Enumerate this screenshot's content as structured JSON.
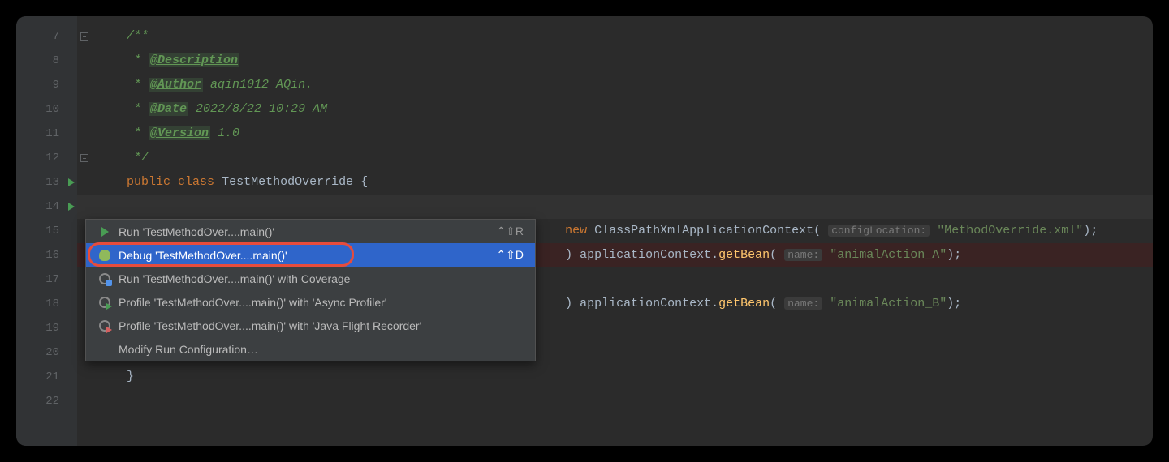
{
  "gutter": {
    "lines": [
      "7",
      "8",
      "9",
      "10",
      "11",
      "12",
      "13",
      "14",
      "15",
      "16",
      "17",
      "18",
      "19",
      "20",
      "21",
      "22"
    ]
  },
  "code": {
    "l7": "/**",
    "l8_star": " * ",
    "l8_tag": "@Description",
    "l9_star": " * ",
    "l9_tag": "@Author",
    "l9_text": " aqin1012 AQin.",
    "l10_star": " * ",
    "l10_tag": "@Date",
    "l10_text": " 2022/8/22 10:29 AM",
    "l11_star": " * ",
    "l11_tag": "@Version",
    "l11_text": " 1.0",
    "l12": " */",
    "l13_kw1": "public",
    "l13_kw2": "class",
    "l13_name": "TestMethodOverride",
    "l13_brace": " {",
    "l15_new": "new ",
    "l15_class": "ClassPathXmlApplicationContext",
    "l15_open": "(",
    "l15_hint": "configLocation:",
    "l15_str": "\"MethodOverride.xml\"",
    "l15_end": ");",
    "l16_close": ") ",
    "l16_obj": "applicationContext",
    "l16_dot": ".",
    "l16_method": "getBean",
    "l16_open": "(",
    "l16_hint": "name:",
    "l16_str": "\"animalAction_A\"",
    "l16_end": ");",
    "l18_close": ") ",
    "l18_obj": "applicationContext",
    "l18_dot": ".",
    "l18_method": "getBean",
    "l18_open": "(",
    "l18_hint": "name:",
    "l18_str": "\"animalAction_B\"",
    "l18_end": ");",
    "l21_brace": "}"
  },
  "menu": {
    "items": [
      {
        "label": "Run 'TestMethodOver....main()'",
        "shortcut": "⌃⇧R"
      },
      {
        "label": "Debug 'TestMethodOver....main()'",
        "shortcut": "⌃⇧D"
      },
      {
        "label": "Run 'TestMethodOver....main()' with Coverage",
        "shortcut": ""
      },
      {
        "label": "Profile 'TestMethodOver....main()' with 'Async Profiler'",
        "shortcut": ""
      },
      {
        "label": "Profile 'TestMethodOver....main()' with 'Java Flight Recorder'",
        "shortcut": ""
      },
      {
        "label": "Modify Run Configuration…",
        "shortcut": ""
      }
    ]
  }
}
